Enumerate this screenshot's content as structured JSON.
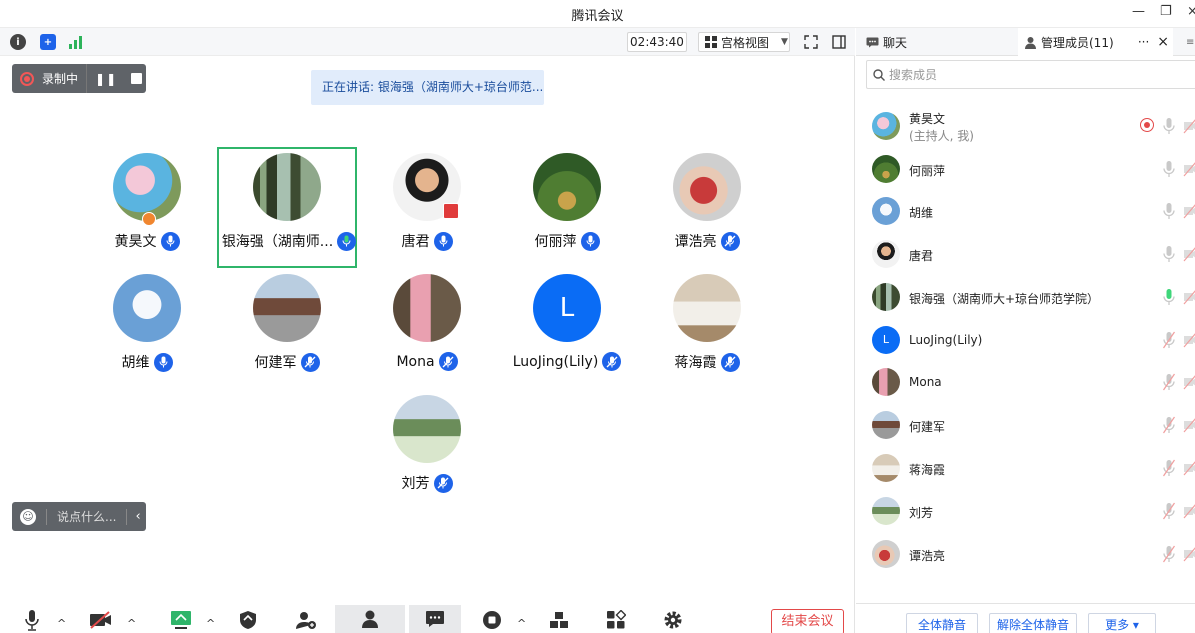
{
  "window": {
    "title": "腾讯会议"
  },
  "topbar": {
    "timer": "02:43:40",
    "view_label": "宫格视图"
  },
  "recording": {
    "label": "录制中"
  },
  "speaking": {
    "text": "正在讲话: 银海强（湖南师大+琼台师范..."
  },
  "tiles": [
    {
      "name": "黄昊文"
    },
    {
      "name": "银海强（湖南师..."
    },
    {
      "name": "唐君"
    },
    {
      "name": "何丽萍"
    },
    {
      "name": "谭浩亮"
    },
    {
      "name": "胡维"
    },
    {
      "name": "何建军"
    },
    {
      "name": "Mona"
    },
    {
      "name": "LuoJing(Lily)",
      "initial": "L"
    },
    {
      "name": "蒋海霞"
    },
    {
      "name": "刘芳"
    }
  ],
  "chat_input": {
    "placeholder": "说点什么..."
  },
  "toolbar": {
    "end_label": "结束会议"
  },
  "sidepanel": {
    "chat_tab": "聊天",
    "members_tab": "管理成员(11)",
    "search_placeholder": "搜索成员",
    "members": [
      {
        "name": "黄昊文",
        "sub": "(主持人, 我)"
      },
      {
        "name": "何丽萍"
      },
      {
        "name": "胡维"
      },
      {
        "name": "唐君"
      },
      {
        "name": "银海强（湖南师大+琼台师范学院）"
      },
      {
        "name": "LuoJing(Lily)",
        "initial": "L"
      },
      {
        "name": "Mona"
      },
      {
        "name": "何建军"
      },
      {
        "name": "蒋海霞"
      },
      {
        "name": "刘芳"
      },
      {
        "name": "谭浩亮"
      }
    ],
    "mute_all": "全体静音",
    "unmute_all": "解除全体静音",
    "more": "更多 ▾"
  },
  "colors": {
    "accent": "#1e63e9",
    "active_border": "#2fb56a",
    "end": "#e34949"
  }
}
